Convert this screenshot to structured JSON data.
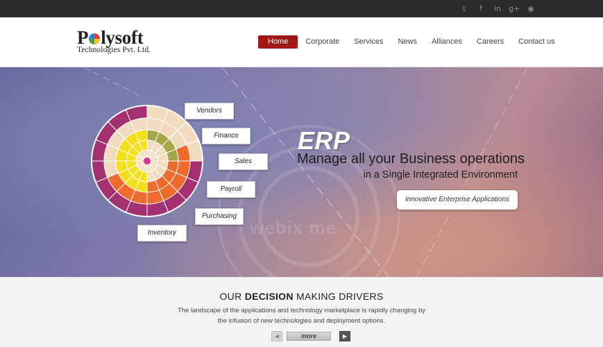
{
  "social": {
    "twitter_glyph": "𝕥",
    "facebook_glyph": "f",
    "linkedin_glyph": "in",
    "googleplus_glyph": "g+",
    "rss_glyph": "◉"
  },
  "brand": {
    "name_pre": "P",
    "name_post": "lysoft",
    "subtitle": "Technologies Pvt. Ltd."
  },
  "nav": {
    "items": [
      "Home",
      "Corporate",
      "Services",
      "News",
      "Alliances",
      "Careers",
      "Contact us"
    ],
    "active": "Home",
    "active_color": "#a21717"
  },
  "hero": {
    "wheel_labels": [
      "Vendors",
      "Finance",
      "Sales",
      "Payroll",
      "Purchasing",
      "Inventory"
    ],
    "headline": "ERP",
    "tagline_line1": "Manage all your Business operations",
    "tagline_line2": "in a Single Integrated Environment",
    "cta_label": "Innovative Enterprise Applications",
    "watermark": "webix  me"
  },
  "decision": {
    "title_pre": "OUR ",
    "title_bold": "DECISION",
    "title_post": " MAKING DRIVERS",
    "text_line1": "The landscape of the applications and technology marketplace is rapidly changing by",
    "text_line2": "the infusion of new technologies and deployment options.",
    "prev_glyph": "◀",
    "more_label": "more",
    "next_glyph": "▶"
  }
}
